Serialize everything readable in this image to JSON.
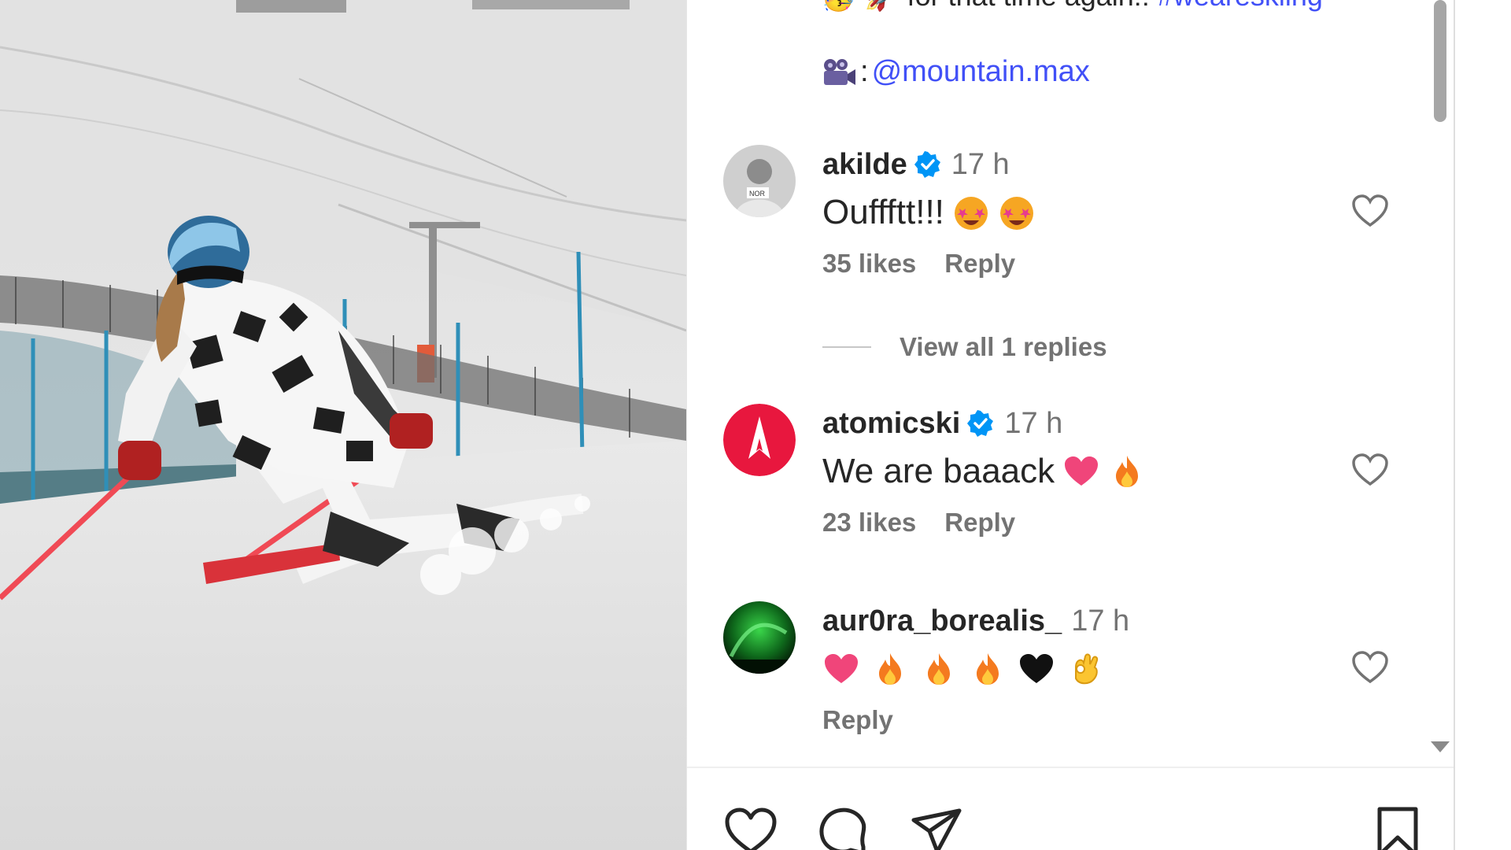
{
  "caption": {
    "cut_text": "🥳 🚀 for that time again!! ",
    "cut_tag": "#weareskiing",
    "credit_prefix": ":",
    "credit_mention": "@mountain.max",
    "credit_icon": "video-camera-icon"
  },
  "comments": [
    {
      "username": "akilde",
      "verified": true,
      "time": "17 h",
      "text": "Ouffftt!!!",
      "emojis": [
        "star-struck-emoji",
        "star-struck-emoji"
      ],
      "likes": "35 likes",
      "reply_label": "Reply",
      "avatar": "akilde-avatar"
    },
    {
      "username": "atomicski",
      "verified": true,
      "time": "17 h",
      "text": "We are baaack",
      "emojis": [
        "pink-heart-emoji",
        "fire-emoji"
      ],
      "likes": "23 likes",
      "reply_label": "Reply",
      "avatar": "atomic-logo-avatar",
      "avatar_color": "#e8173e"
    },
    {
      "username": "aur0ra_borealis_",
      "verified": false,
      "time": "17 h",
      "text": "",
      "emojis": [
        "pink-heart-emoji",
        "fire-emoji",
        "fire-emoji",
        "fire-emoji",
        "black-heart-emoji",
        "ok-hand-emoji"
      ],
      "likes": "",
      "reply_label": "Reply",
      "avatar": "aurora-avatar"
    }
  ],
  "view_replies": "View all 1 replies",
  "actions": {
    "like": "heart-icon",
    "comment": "comment-bubble-icon",
    "share": "paper-plane-icon",
    "save": "bookmark-icon"
  },
  "colors": {
    "link": "#4150f7",
    "muted": "#737373",
    "verified": "#0095f6",
    "atomic_red": "#e8173e"
  }
}
